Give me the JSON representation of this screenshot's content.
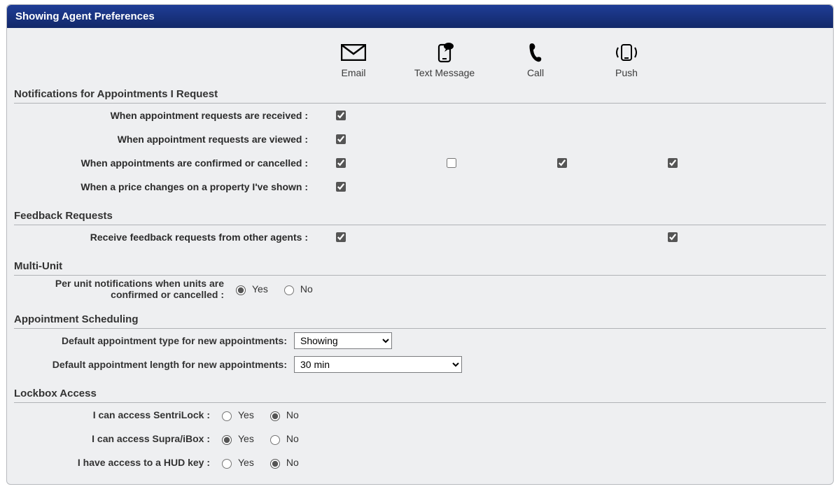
{
  "panel": {
    "title": "Showing Agent Preferences"
  },
  "columns": {
    "email": "Email",
    "text": "Text Message",
    "call": "Call",
    "push": "Push"
  },
  "sections": {
    "notif": {
      "title": "Notifications for Appointments I Request"
    },
    "feedback": {
      "title": "Feedback Requests"
    },
    "multi": {
      "title": "Multi-Unit"
    },
    "sched": {
      "title": "Appointment Scheduling"
    },
    "lockbox": {
      "title": "Lockbox Access"
    }
  },
  "rows": {
    "received": "When appointment requests are received :",
    "viewed": "When appointment requests are viewed :",
    "confirmed": "When appointments are confirmed or cancelled :",
    "price": "When a price changes on a property I've shown :",
    "feedback_other": "Receive feedback requests from other agents :"
  },
  "multi": {
    "perunit_a": "Per unit notifications when units are",
    "perunit_b": "confirmed or cancelled :",
    "yes": "Yes",
    "no": "No"
  },
  "sched": {
    "type_label": "Default appointment type for new appointments:",
    "length_label": "Default appointment length for new appointments:",
    "type_value": "Showing",
    "length_value": "30 min"
  },
  "lockbox": {
    "sentri": "I can access SentriLock :",
    "supra": "I can access Supra/iBox :",
    "hud": "I have access to a HUD key :",
    "yes": "Yes",
    "no": "No"
  }
}
